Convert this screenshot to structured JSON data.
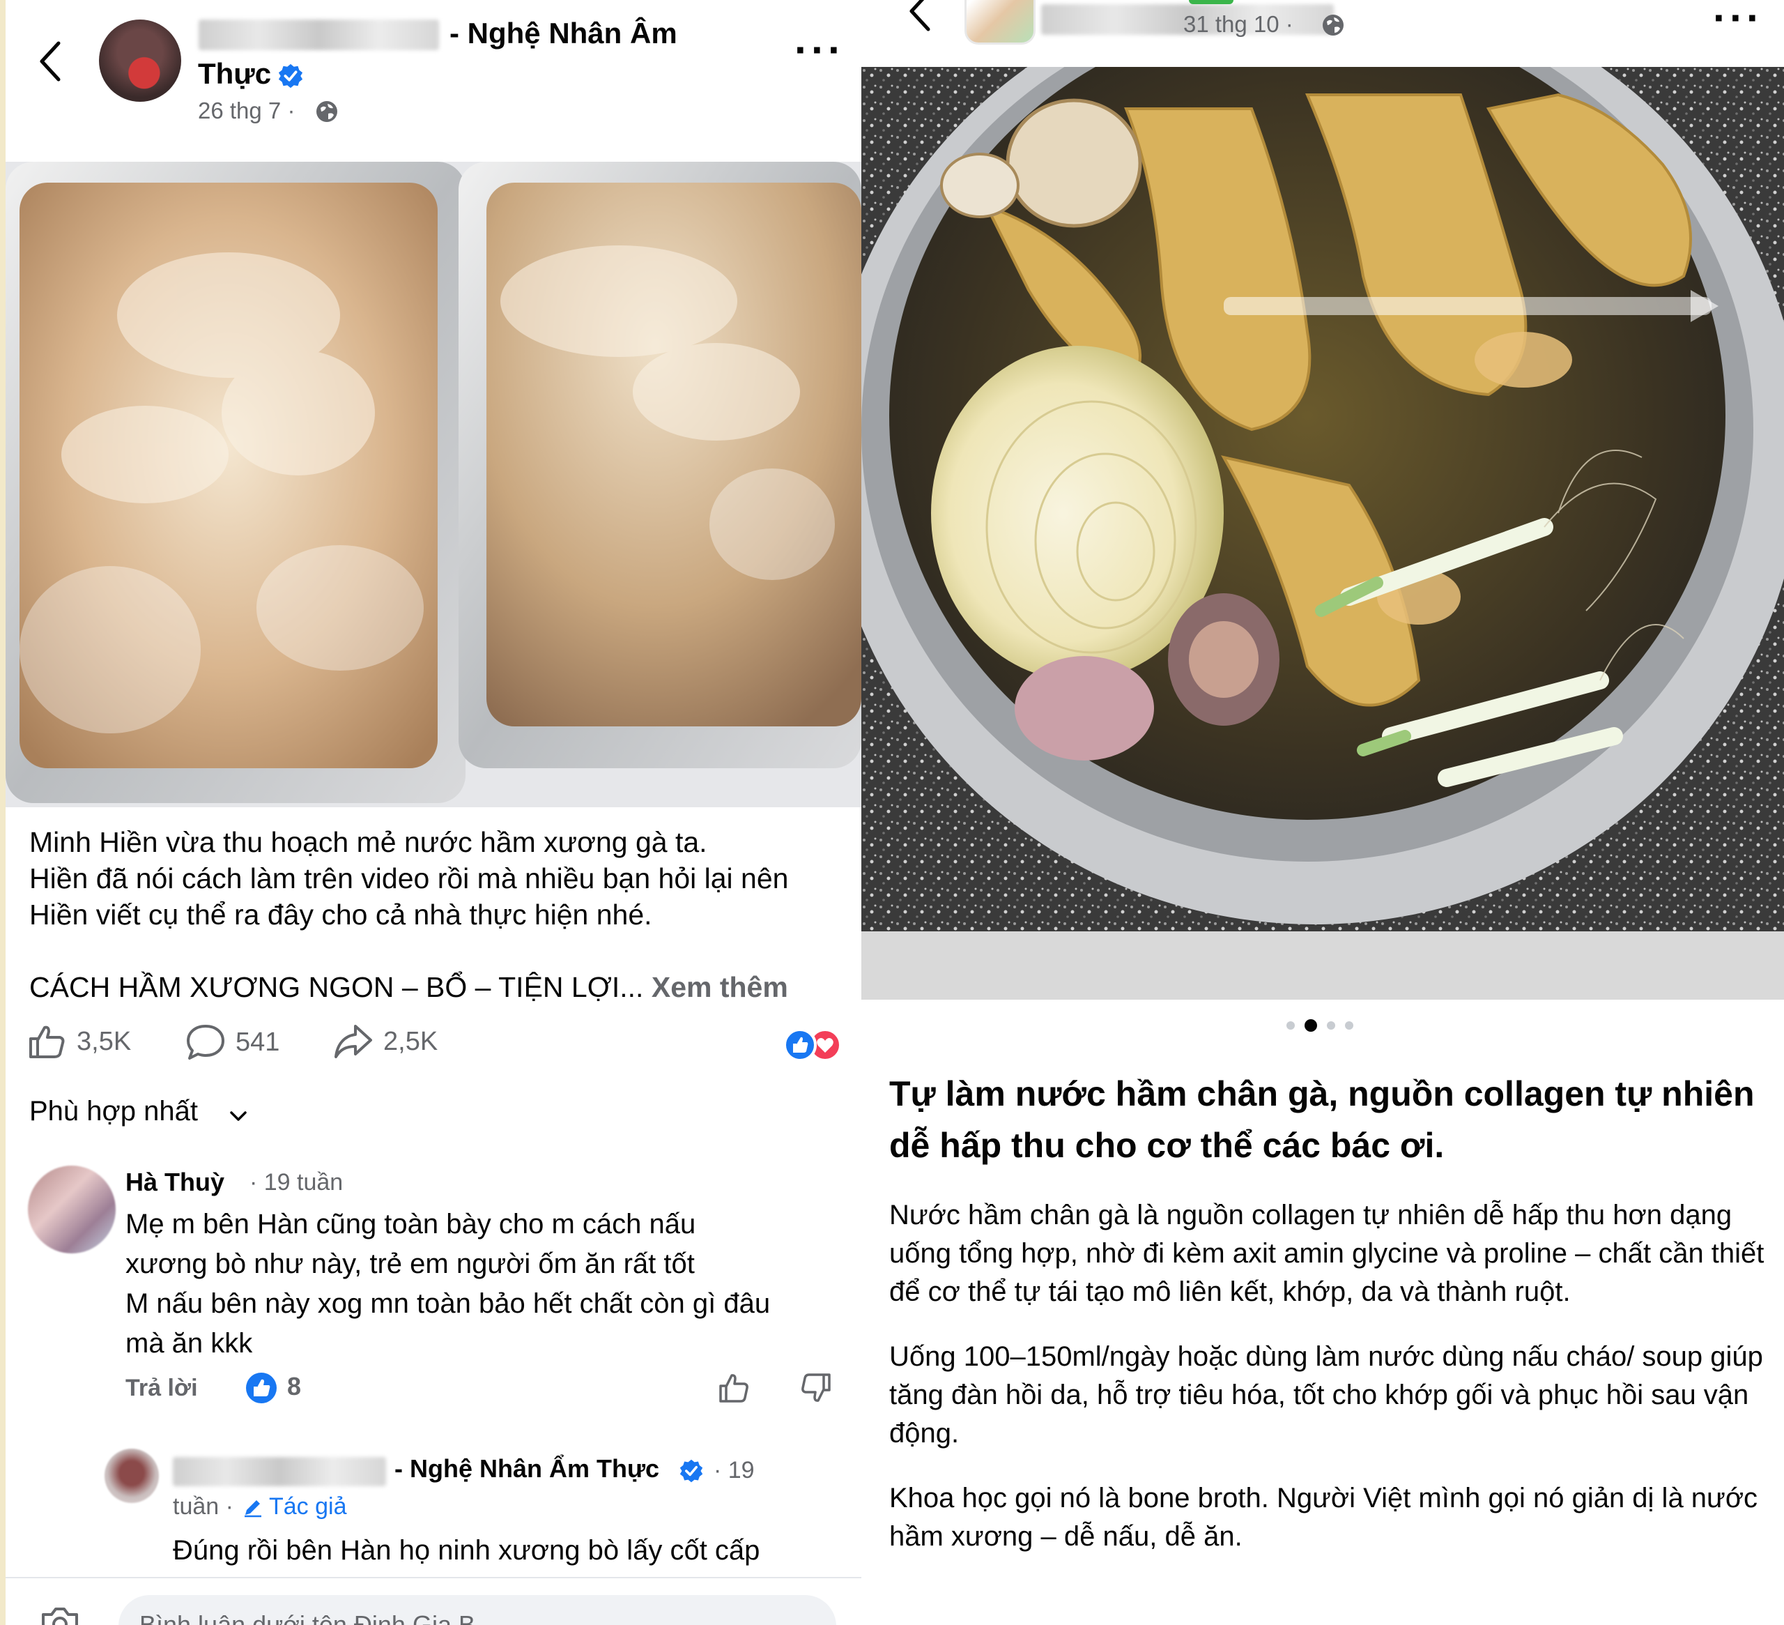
{
  "left_post": {
    "author_suffix": "- Nghệ Nhân Âm",
    "author_line2": "Thực",
    "timestamp": "26 thg 7 ·",
    "caption": [
      "Minh Hiền vừa thu hoạch mẻ nước hầm xương gà ta.",
      "Hiền đã nói cách làm trên video rồi mà nhiều bạn hỏi lại nên",
      "Hiền viết cụ thể ra đây cho cả nhà thực hiện nhé."
    ],
    "caption_heading": "CÁCH HẦM XƯƠNG NGON – BỔ – TIỆN LỢI...",
    "see_more": "Xem thêm",
    "stats": {
      "likes": "3,5K",
      "comments": "541",
      "shares": "2,5K"
    },
    "sort_label": "Phù hợp nhất",
    "comments": [
      {
        "name": "Hà Thuỳ",
        "time": "· 19 tuần",
        "text": [
          "Mẹ m bên Hàn cũng toàn bày cho m cách nấu",
          "xương bò như này, trẻ em người ốm ăn rất tốt",
          "M nấu bên này xog mn toàn bảo hết chất còn gì đâu",
          "mà ăn kkk"
        ],
        "reply_label": "Trả lời",
        "like_count": "8"
      },
      {
        "name_suffix": "- Nghệ Nhân Ẩm Thực",
        "time_part1": "· 19",
        "time_part2": "tuần ·",
        "author_tag": "Tác giả",
        "text": "Đúng rồi bên Hàn họ ninh xương bò lấy cốt cấp"
      }
    ],
    "comment_placeholder": "Bình luận dưới tên Đinh Gia B..."
  },
  "right_post": {
    "timestamp": "31 thg 10 ·",
    "carousel": {
      "count": 4,
      "active": 1
    },
    "title": "Tự làm nước hầm chân gà, nguồn collagen tự nhiên dễ hấp thu cho cơ thể các bác ơi.",
    "paragraphs": [
      "Nước hầm chân gà là nguồn collagen tự nhiên dễ hấp thu hơn dạng uống tổng hợp, nhờ đi kèm axit amin glycine và proline – chất cần thiết để cơ thể tự tái tạo mô liên kết, khớp, da và thành ruột.",
      "Uống 100–150ml/ngày hoặc dùng làm nước dùng nấu cháo/ soup giúp tăng đàn hồi da, hỗ trợ tiêu hóa, tốt cho khớp gối và phục hồi sau vận động.",
      "Khoa học gọi nó là bone broth. Người Việt mình gọi nó giản dị là nước hầm xương – dễ nấu, dễ ăn."
    ]
  },
  "colors": {
    "facebook_blue": "#1877f2",
    "secondary_text": "#65676b",
    "love_red": "#f33e58"
  }
}
